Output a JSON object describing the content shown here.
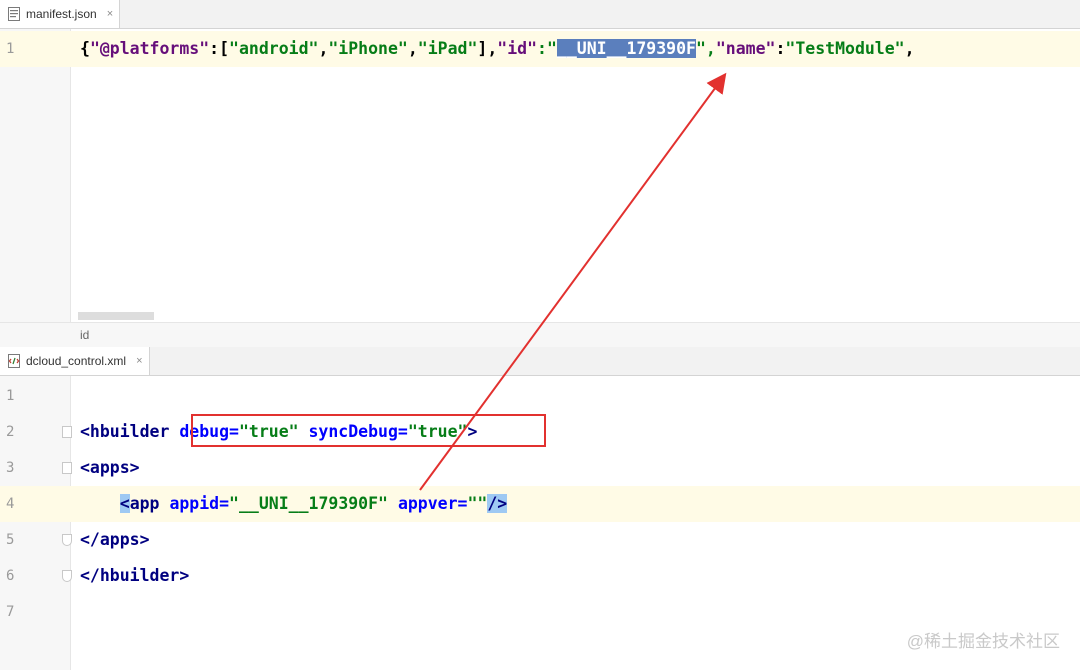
{
  "top_panel": {
    "tab": {
      "label": "manifest.json",
      "close": "×"
    },
    "lines": [
      {
        "number": "1"
      }
    ],
    "json": {
      "open_brace": "{",
      "platforms_key": "\"@platforms\"",
      "colon1": ":[",
      "p1": "\"android\"",
      "p2": "\"iPhone\"",
      "p3": "\"iPad\"",
      "close_arr": "],",
      "id_key": "\"id\"",
      "colon2": ":\"",
      "id_value": "__UNI__179390F",
      "after_id": "\",",
      "name_key": "\"name\"",
      "colon3": ":",
      "name_value": "\"TestModule\"",
      "comma": ","
    },
    "breadcrumb": "id"
  },
  "bottom_panel": {
    "tab": {
      "label": "dcloud_control.xml",
      "close": "×"
    },
    "line_numbers": [
      "1",
      "2",
      "3",
      "4",
      "5",
      "6",
      "7"
    ],
    "xml": {
      "l2_open": "<hbuilder",
      "l2_attr1": "debug",
      "l2_eq1": "=",
      "l2_val1": "\"true\"",
      "l2_attr2": "syncDebug",
      "l2_eq2": "=",
      "l2_val2": "\"true\"",
      "l2_close": ">",
      "l3": "<apps>",
      "l4_lt": "<",
      "l4_tag": "app",
      "l4_attr1": "appid",
      "l4_eq1": "=",
      "l4_val1": "\"__UNI__179390F\"",
      "l4_attr2": "appver",
      "l4_eq2": "=",
      "l4_val2": "\"\"",
      "l4_end": "/>",
      "l5": "</apps>",
      "l6": "</hbuilder>"
    }
  },
  "annotation": {
    "arrow_color": "#e2312f"
  },
  "watermark": "@稀土掘金技术社区"
}
